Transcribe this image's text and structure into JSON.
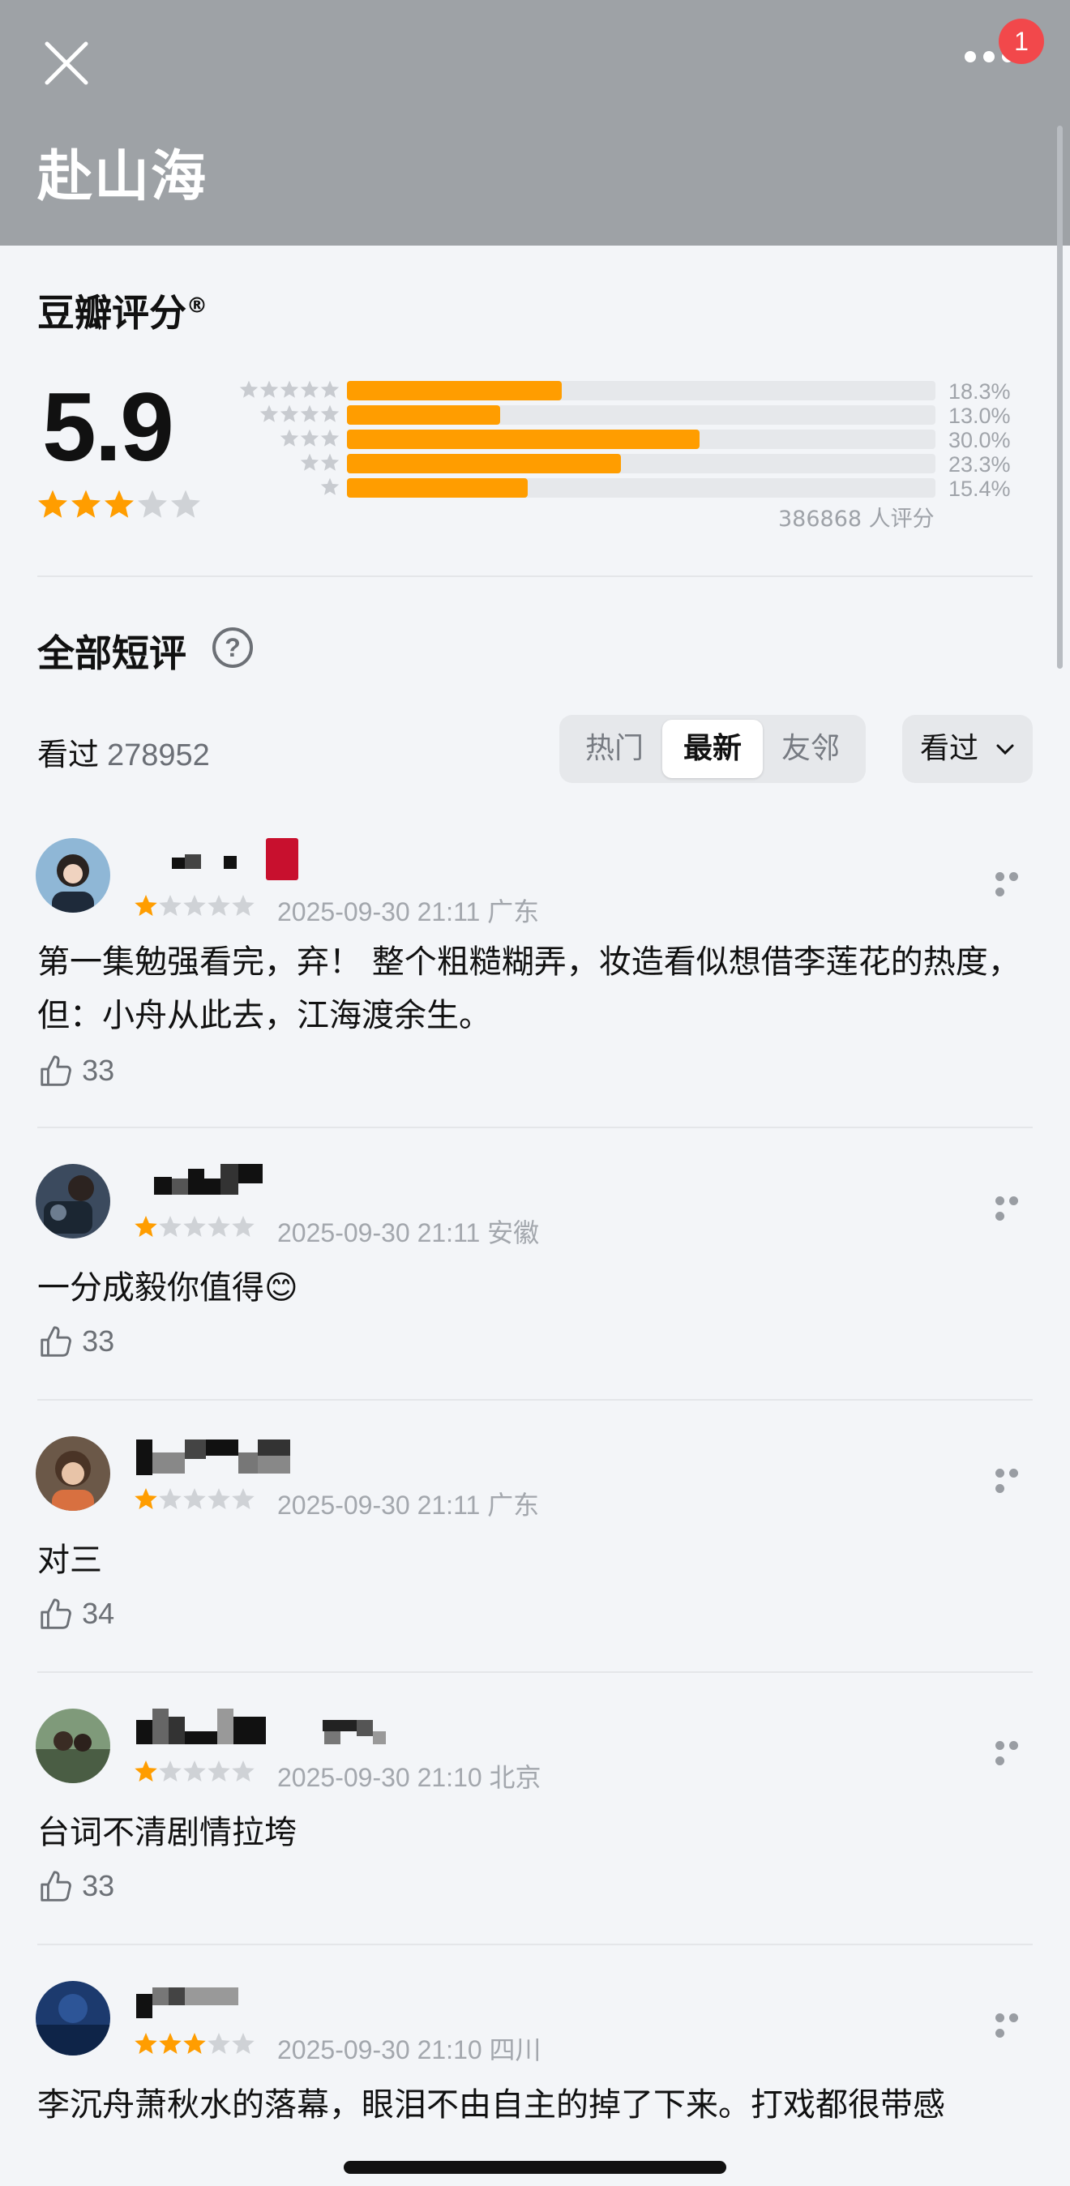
{
  "header": {
    "title": "赴山海",
    "notification_count": "1"
  },
  "rating": {
    "title": "豆瓣评分",
    "registered_mark": "®",
    "score": "5.9",
    "score_stars": 3,
    "distribution": [
      {
        "stars": 5,
        "percent_label": "18.3%",
        "fraction": 0.183
      },
      {
        "stars": 4,
        "percent_label": "13.0%",
        "fraction": 0.13
      },
      {
        "stars": 3,
        "percent_label": "30.0%",
        "fraction": 0.3
      },
      {
        "stars": 2,
        "percent_label": "23.3%",
        "fraction": 0.233
      },
      {
        "stars": 1,
        "percent_label": "15.4%",
        "fraction": 0.154
      }
    ],
    "total_count": "386868 人评分"
  },
  "short_reviews": {
    "title": "全部短评",
    "help_symbol": "?",
    "seen_label": "看过",
    "seen_count": "278952",
    "tabs": [
      "热门",
      "最新",
      "友邻"
    ],
    "active_tab": "最新",
    "filter_label": "看过"
  },
  "reviews": [
    {
      "stars": 1,
      "time": "2025-09-30 21:11",
      "location": "广东",
      "text": "第一集勉强看完，弃！ 整个粗糙糊弄，妆造看似想借李莲花的热度，但：小舟从此去，江海渡余生。",
      "likes": "33"
    },
    {
      "stars": 1,
      "time": "2025-09-30 21:11",
      "location": "安徽",
      "text": "一分成毅你值得😊",
      "likes": "33"
    },
    {
      "stars": 1,
      "time": "2025-09-30 21:11",
      "location": "广东",
      "text": "对三",
      "likes": "34"
    },
    {
      "stars": 1,
      "time": "2025-09-30 21:10",
      "location": "北京",
      "text": "台词不清剧情拉垮",
      "likes": "33"
    },
    {
      "stars": 3,
      "time": "2025-09-30 21:10",
      "location": "四川",
      "text": "李沉舟萧秋水的落幕，眼泪不由自主的掉了下来。打戏都很带感",
      "likes": ""
    }
  ],
  "colors": {
    "header_bg": "#9ea2a6",
    "accent_star": "#ff9d00",
    "badge": "#f2484b"
  }
}
